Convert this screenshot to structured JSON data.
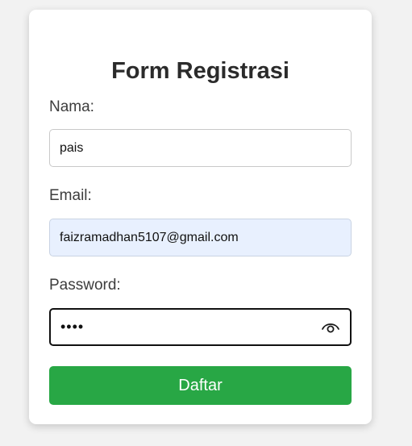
{
  "form": {
    "title": "Form Registrasi",
    "name_label": "Nama:",
    "name_value": "pais",
    "email_label": "Email:",
    "email_value": "faizramadhan5107@gmail.com",
    "password_label": "Password:",
    "password_value": "abcd",
    "password_toggle_icon": "eye-icon",
    "submit_label": "Daftar"
  },
  "colors": {
    "background": "#f2f2f2",
    "card": "#ffffff",
    "submit_button": "#28a745",
    "autofill_field": "#e8f0fe"
  }
}
